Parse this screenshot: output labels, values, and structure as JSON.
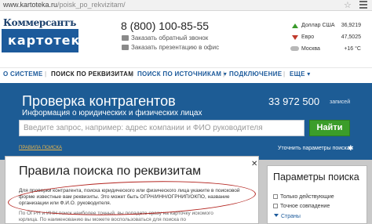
{
  "browser": {
    "url_host": "www.kartoteka.ru",
    "url_path": "/poisk_po_rekvizitam/"
  },
  "logo": {
    "top": "Коммерсантъ",
    "box": "картотека"
  },
  "contacts": {
    "phone": "8 (800) 100-85-55",
    "callback": "Заказать обратный звонок",
    "presentation": "Заказать презентацию в офис"
  },
  "ticker": [
    {
      "name": "Доллар США",
      "value": "36,9219",
      "direction": "up"
    },
    {
      "name": "Евро",
      "value": "47,5025",
      "direction": "down"
    },
    {
      "name": "Москва",
      "value": "+16 °C",
      "icon": "cloud-icon"
    }
  ],
  "nav": {
    "items": [
      "О СИСТЕМЕ",
      "ПОИСК ПО РЕКВИЗИТАМ",
      "ПОИСК ПО ИСТОЧНИКАМ ▾",
      "ПОДКЛЮЧЕНИЕ",
      "ЕЩЕ ▾"
    ]
  },
  "hero": {
    "title": "Проверка контрагентов",
    "subtitle": "Информация о юридических и физических лицах",
    "count": "33 972 500",
    "count_unit": "записей",
    "search_placeholder": "Введите запрос, например: адрес компании и ФИО руководителя",
    "find_button": "Найти",
    "rules_link": "ПРАВИЛА ПОИСКА",
    "refine_link": "Уточнить параметры поиска"
  },
  "rules_panel": {
    "title": "Правила поиска по реквизитам",
    "lines": [
      "Для проверки контрагента, поиска юридического или физического лица укажите в поисковой",
      "форме известные вам реквизиты. Это может быть ОГРН/ИНН/ОГРНИП/ОКПО, название",
      "организации или Ф.И.О. руководителя.",
      "По ОГРН и ИНН поиск наиболее точный, вы попадете сразу на карточку искомого",
      "юрлица. По наименованию вы можете воспользоваться для поиска по"
    ]
  },
  "params_panel": {
    "title": "Параметры поиска",
    "options": [
      "Только действующие",
      "Точное совпадение"
    ],
    "countries": "Страны"
  },
  "colors": {
    "brand_blue": "#1d5c95",
    "find_green": "#3b9d2a",
    "annotation_red": "#b3231e"
  }
}
